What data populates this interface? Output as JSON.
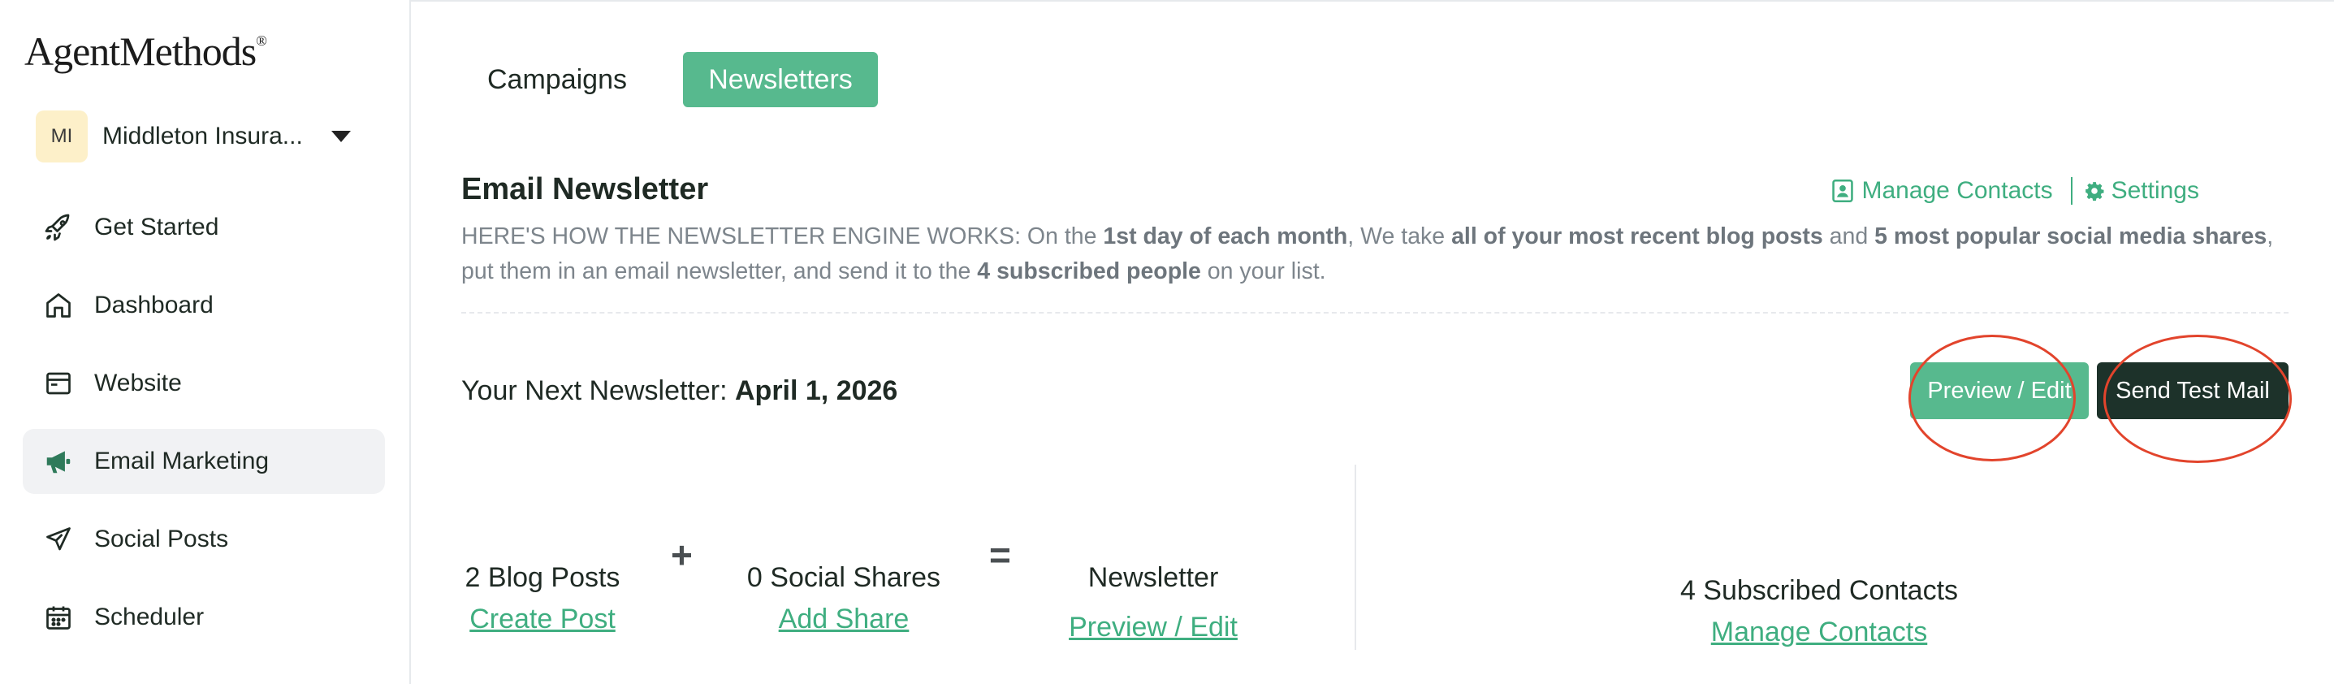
{
  "brand": {
    "logo_text": "AgentMethods",
    "logo_mark": "®"
  },
  "account": {
    "initials": "MI",
    "name": "Middleton Insura..."
  },
  "sidebar": {
    "items": [
      {
        "label": "Get Started",
        "icon": "rocket-icon"
      },
      {
        "label": "Dashboard",
        "icon": "home-icon"
      },
      {
        "label": "Website",
        "icon": "browser-window-icon"
      },
      {
        "label": "Email Marketing",
        "icon": "megaphone-icon",
        "active": true
      },
      {
        "label": "Social Posts",
        "icon": "paper-plane-icon"
      },
      {
        "label": "Scheduler",
        "icon": "calendar-icon"
      }
    ]
  },
  "tabs": [
    {
      "label": "Campaigns",
      "active": false
    },
    {
      "label": "Newsletters",
      "active": true
    }
  ],
  "newsletter": {
    "title": "Email Newsletter",
    "manage_contacts_link": "Manage Contacts",
    "settings_link": "Settings",
    "description": {
      "p1": "HERE'S HOW THE NEWSLETTER ENGINE WORKS: On the ",
      "b1": "1st day of each month",
      "p2": ", We take ",
      "b2": "all of your most recent blog posts",
      "p3": " and ",
      "b3": "5 most popular social media shares",
      "p4": ", put them in an email newsletter, and send it to the ",
      "b4": "4 subscribed people",
      "p5": " on your list."
    },
    "next_label": "Your Next Newsletter: ",
    "next_date": "April 1, 2026",
    "preview_button": "Preview / Edit",
    "send_test_button": "Send Test Mail",
    "blog_posts": "2 Blog Posts",
    "create_post_link": "Create Post",
    "plus_symbol": "+",
    "social_shares": "0 Social Shares",
    "add_share_link": "Add Share",
    "equals_symbol": "=",
    "newsletter_label": "Newsletter",
    "newsletter_preview_link": "Preview / Edit",
    "subscribed_contacts": "4 Subscribed Contacts",
    "manage_contacts_bottom_link": "Manage Contacts"
  },
  "colors": {
    "accent_green": "#57b98e",
    "link_green": "#3fae80",
    "dark_button": "#1d322a",
    "annotation_red": "#e2442c",
    "avatar_bg": "#fdf0c9"
  }
}
